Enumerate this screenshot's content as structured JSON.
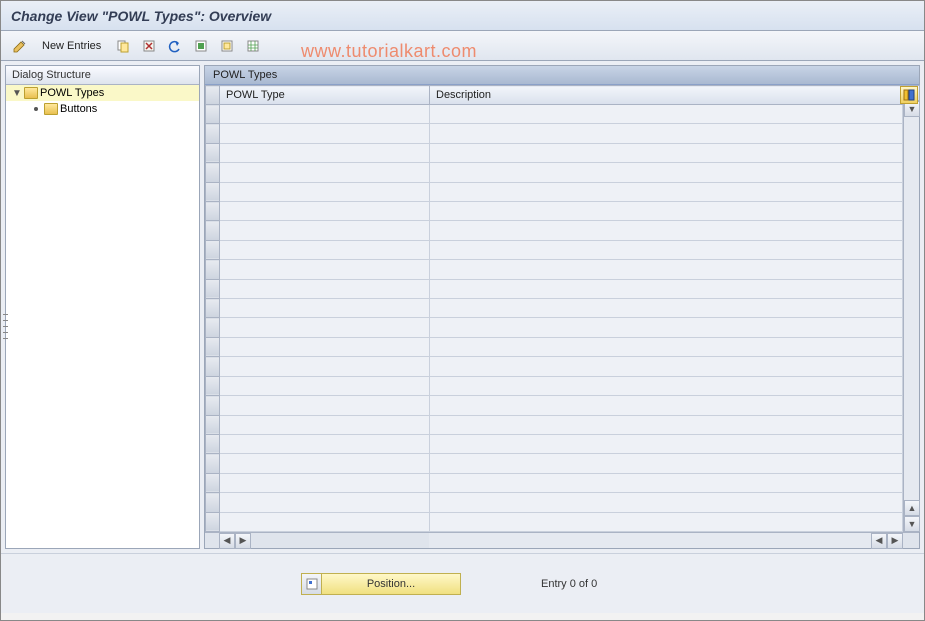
{
  "title": "Change View \"POWL Types\": Overview",
  "watermark": "www.tutorialkart.com",
  "toolbar": {
    "new_entries_label": "New Entries"
  },
  "tree": {
    "header": "Dialog Structure",
    "nodes": [
      {
        "label": "POWL Types",
        "selected": true,
        "expanded": true
      },
      {
        "label": "Buttons",
        "selected": false,
        "child": true
      }
    ]
  },
  "table": {
    "title": "POWL Types",
    "columns": [
      {
        "label": "POWL Type"
      },
      {
        "label": "Description"
      }
    ],
    "rows": 22
  },
  "footer": {
    "position_label": "Position...",
    "entry_text": "Entry 0 of 0"
  }
}
